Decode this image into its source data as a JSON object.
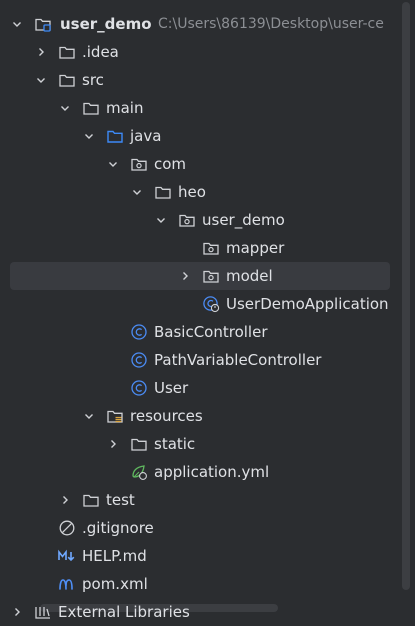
{
  "colors": {
    "background": "#2b2d30",
    "selection": "#393b40",
    "text": "#dfe1e5",
    "muted": "#8c8f94",
    "blue_folder": "#3d8af7",
    "class_icon": "#4b8cf5",
    "yaml_green": "#5fb85f",
    "md_blue": "#6fa8ff",
    "maven_blue": "#4f8ff7"
  },
  "tree": [
    {
      "label": "user_demo",
      "path": "C:\\Users\\86139\\Desktop\\user-ce",
      "icon": "module-folder-icon",
      "expanded": true
    },
    {
      "label": ".idea",
      "icon": "folder-icon",
      "expanded": false
    },
    {
      "label": "src",
      "icon": "folder-icon",
      "expanded": true
    },
    {
      "label": "main",
      "icon": "folder-icon",
      "expanded": true
    },
    {
      "label": "java",
      "icon": "source-root-folder-icon",
      "expanded": true
    },
    {
      "label": "com",
      "icon": "package-icon",
      "expanded": true
    },
    {
      "label": "heo",
      "icon": "folder-icon",
      "expanded": true
    },
    {
      "label": "user_demo",
      "icon": "package-icon",
      "expanded": true
    },
    {
      "label": "mapper",
      "icon": "package-icon"
    },
    {
      "label": "model",
      "icon": "package-icon",
      "expanded": false,
      "selected": true
    },
    {
      "label": "UserDemoApplication",
      "icon": "spring-boot-class-icon"
    },
    {
      "label": "BasicController",
      "icon": "class-icon"
    },
    {
      "label": "PathVariableController",
      "icon": "class-icon"
    },
    {
      "label": "User",
      "icon": "class-icon"
    },
    {
      "label": "resources",
      "icon": "resources-folder-icon",
      "expanded": true
    },
    {
      "label": "static",
      "icon": "folder-icon",
      "expanded": false
    },
    {
      "label": "application.yml",
      "icon": "yaml-config-icon"
    },
    {
      "label": "test",
      "icon": "folder-icon",
      "expanded": false
    },
    {
      "label": ".gitignore",
      "icon": "gitignore-icon"
    },
    {
      "label": "HELP.md",
      "icon": "markdown-icon"
    },
    {
      "label": "pom.xml",
      "icon": "maven-icon"
    },
    {
      "label": "External Libraries",
      "icon": "libraries-icon",
      "expanded": false
    }
  ]
}
